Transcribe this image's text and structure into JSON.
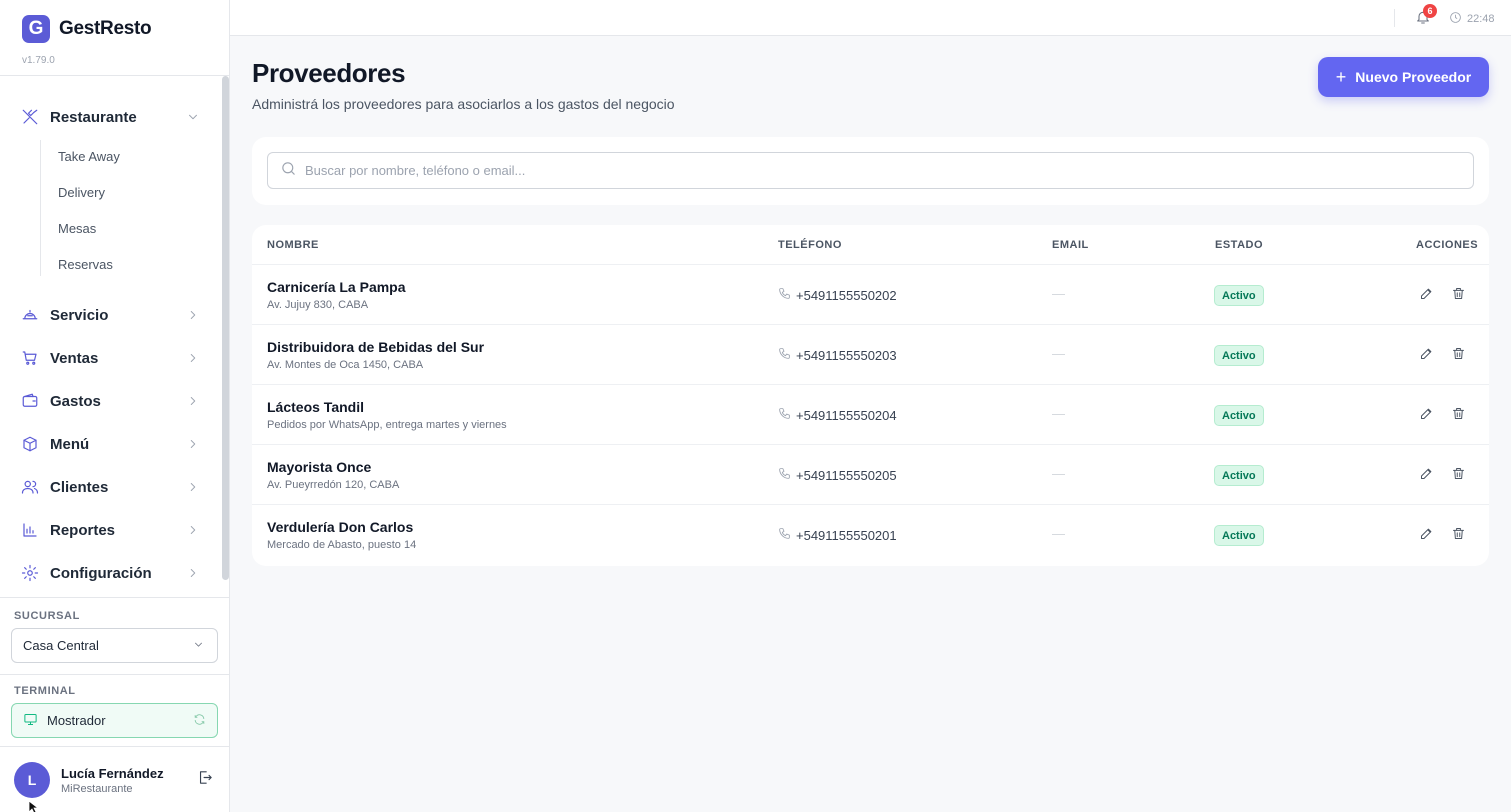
{
  "app": {
    "name": "GestResto",
    "logo_letter": "G",
    "version": "v1.79.0",
    "accent": "#5b5bd6"
  },
  "topbar": {
    "notification_count": "6",
    "time": "22:48"
  },
  "sidebar": {
    "nav": [
      {
        "label": "Restaurante",
        "icon": "utensils-icon",
        "expanded": true
      },
      {
        "label": "Servicio",
        "icon": "cloche-icon"
      },
      {
        "label": "Ventas",
        "icon": "cart-icon"
      },
      {
        "label": "Gastos",
        "icon": "wallet-icon"
      },
      {
        "label": "Menú",
        "icon": "box-icon"
      },
      {
        "label": "Clientes",
        "icon": "users-icon"
      },
      {
        "label": "Reportes",
        "icon": "bar-chart-icon"
      },
      {
        "label": "Configuración",
        "icon": "gear-icon"
      }
    ],
    "sub_items": [
      "Take Away",
      "Delivery",
      "Mesas",
      "Reservas"
    ],
    "branch_label": "SUCURSAL",
    "branch_value": "Casa Central",
    "terminal_label": "TERMINAL",
    "terminal_value": "Mostrador",
    "user": {
      "initial": "L",
      "name": "Lucía Fernández",
      "org": "MiRestaurante"
    }
  },
  "page": {
    "title": "Proveedores",
    "subtitle": "Administrá los proveedores para asociarlos a los gastos del negocio",
    "new_button": "Nuevo Proveedor",
    "search_placeholder": "Buscar por nombre, teléfono o email..."
  },
  "table": {
    "columns": [
      "NOMBRE",
      "TELÉFONO",
      "EMAIL",
      "ESTADO",
      "ACCIONES"
    ],
    "rows": [
      {
        "name": "Carnicería La Pampa",
        "note": "Av. Jujuy 830, CABA",
        "phone": "+5491155550202",
        "email": "—",
        "status": "Activo"
      },
      {
        "name": "Distribuidora de Bebidas del Sur",
        "note": "Av. Montes de Oca 1450, CABA",
        "phone": "+5491155550203",
        "email": "—",
        "status": "Activo"
      },
      {
        "name": "Lácteos Tandil",
        "note": "Pedidos por WhatsApp, entrega martes y viernes",
        "phone": "+5491155550204",
        "email": "—",
        "status": "Activo"
      },
      {
        "name": "Mayorista Once",
        "note": "Av. Pueyrredón 120, CABA",
        "phone": "+5491155550205",
        "email": "—",
        "status": "Activo"
      },
      {
        "name": "Verdulería Don Carlos",
        "note": "Mercado de Abasto, puesto 14",
        "phone": "+5491155550201",
        "email": "—",
        "status": "Activo"
      }
    ]
  }
}
